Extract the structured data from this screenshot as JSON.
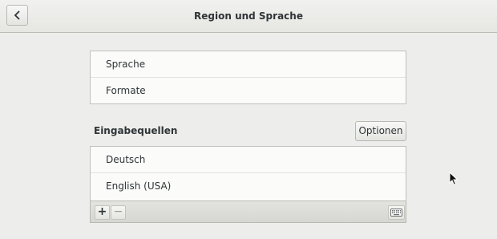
{
  "header": {
    "title": "Region und Sprache",
    "back_icon": "chevron-left-icon"
  },
  "region_list": {
    "items": [
      {
        "label": "Sprache"
      },
      {
        "label": "Formate"
      }
    ]
  },
  "input_sources": {
    "section_label": "Eingabequellen",
    "options_label": "Optionen",
    "items": [
      {
        "label": "Deutsch"
      },
      {
        "label": "English (USA)"
      }
    ],
    "toolbar": {
      "add_label": "+",
      "remove_label": "−",
      "keyboard_icon": "keyboard-icon"
    }
  },
  "colors": {
    "background": "#ededeb",
    "list_background": "#fbfbfa",
    "text": "#2e3436"
  }
}
